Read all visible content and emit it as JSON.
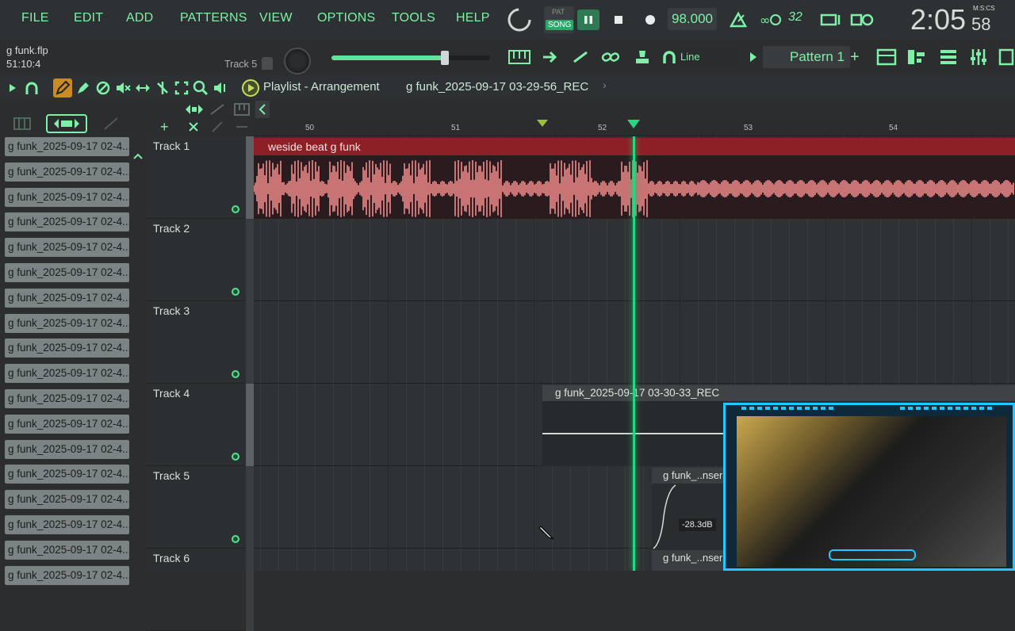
{
  "menu": [
    "FILE",
    "EDIT",
    "ADD",
    "PATTERNS",
    "VIEW",
    "OPTIONS",
    "TOOLS",
    "HELP"
  ],
  "transport": {
    "pat_label": "PAT",
    "song_label": "SONG",
    "tempo": "98.000",
    "time": "2:05",
    "time_small": "58",
    "time_unit": "M:S:CS",
    "cpu": "32"
  },
  "hint": {
    "file": "g funk.flp",
    "position": "51:10:4",
    "track": "Track 5"
  },
  "toolbar2": {
    "snap": "Line",
    "pattern": "Pattern 1"
  },
  "playlist": {
    "title": "Playlist - Arrangement",
    "crumb": "g funk_2025-09-17 03-29-56_REC"
  },
  "ruler": [
    "50",
    "51",
    "52",
    "53",
    "54"
  ],
  "browser": [
    "g funk_2025-09-17 02-4...",
    "g funk_2025-09-17 02-4...",
    "g funk_2025-09-17 02-4...",
    "g funk_2025-09-17 02-4...",
    "g funk_2025-09-17 02-4...",
    "g funk_2025-09-17 02-4...",
    "g funk_2025-09-17 02-4...",
    "g funk_2025-09-17 02-4...",
    "g funk_2025-09-17 02-4...",
    "g funk_2025-09-17 02-4...",
    "g funk_2025-09-17 02-4...",
    "g funk_2025-09-17 02-4...",
    "g funk_2025-09-17 02-4...",
    "g funk_2025-09-17 02-4...",
    "g funk_2025-09-17 02-4...",
    "g funk_2025-09-17 02-4...",
    "g funk_2025-09-17 02-4...",
    "g funk_2025-09-17 02-4..."
  ],
  "tracks": [
    "Track 1",
    "Track 2",
    "Track 3",
    "Track 4",
    "Track 5",
    "Track 6"
  ],
  "clips": {
    "c1": "weside beat g funk",
    "c4": "g funk_2025-09-17 03-30-33_REC",
    "c5": "g funk_..nser",
    "c5_db": "-28.3dB",
    "c6": "g funk_..nser"
  },
  "colors": {
    "accent": "#7ef0a8",
    "clip_red": "#8d1f26",
    "wave": "#f08a8a",
    "playhead": "#27d680"
  }
}
